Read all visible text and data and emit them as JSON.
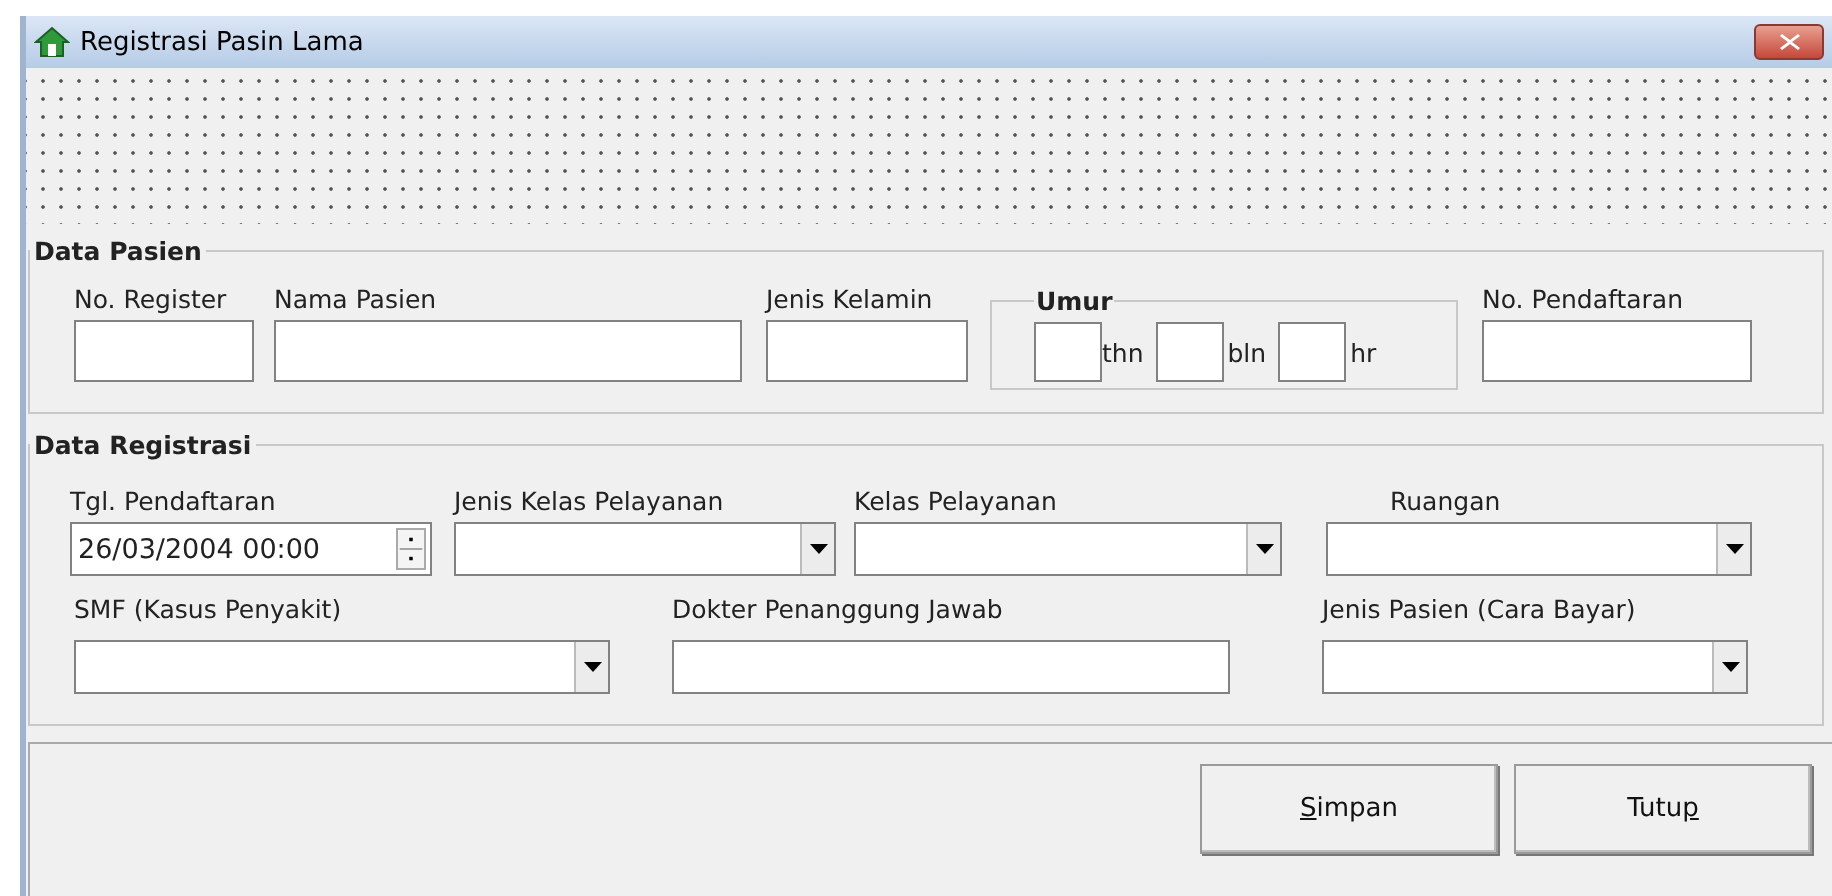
{
  "window": {
    "title": "Registrasi Pasin Lama"
  },
  "data_pasien": {
    "legend": "Data Pasien",
    "fields": [
      {
        "label": "No. Register",
        "kind": "text"
      },
      {
        "label": "Nama Pasien",
        "kind": "text"
      },
      {
        "label": "Jenis Kelamin",
        "kind": "text"
      }
    ],
    "umur": {
      "legend": "Umur",
      "units": [
        "thn",
        "bln",
        "hr"
      ]
    },
    "no_pendaftaran": {
      "label": "No. Pendaftaran",
      "kind": "text"
    }
  },
  "data_registrasi": {
    "legend": "Data Registrasi",
    "fields": [
      {
        "label": "Tgl. Pendaftaran",
        "kind": "datetime",
        "value": "26/03/2004 00:00"
      },
      {
        "label": "Jenis Kelas Pelayanan",
        "kind": "combo"
      },
      {
        "label": "Kelas Pelayanan",
        "kind": "combo"
      },
      {
        "label": "Ruangan",
        "kind": "combo"
      },
      {
        "label": "SMF (Kasus Penyakit)",
        "kind": "combo"
      },
      {
        "label": "Dokter Penanggung Jawab",
        "kind": "text"
      },
      {
        "label": "Jenis Pasien (Cara Bayar)",
        "kind": "combo"
      }
    ]
  },
  "buttons": [
    {
      "underlined": "S",
      "after": "impan"
    },
    {
      "before": "Tutu",
      "underlined": "p"
    }
  ]
}
